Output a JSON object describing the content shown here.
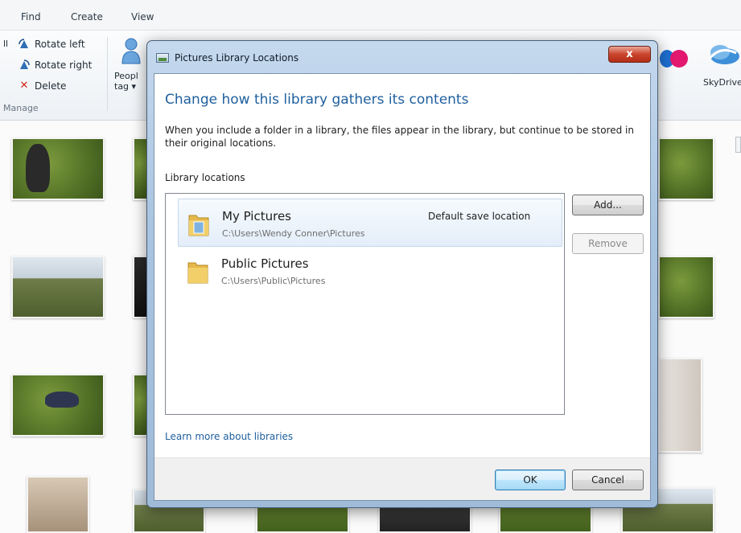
{
  "app": {
    "menu": [
      "Find",
      "Create",
      "View"
    ],
    "ribbon": {
      "items": [
        {
          "icon": "rotate-left-icon",
          "label": "Rotate left"
        },
        {
          "icon": "rotate-right-icon",
          "label": "Rotate right"
        },
        {
          "icon": "delete-icon",
          "label": "Delete"
        }
      ],
      "group_label": "Manage",
      "people_tag_line1": "Peopl",
      "people_tag_line2": "tag ▾",
      "skydrive_label": "SkyDrive"
    }
  },
  "dialog": {
    "title": "Pictures Library Locations",
    "close_glyph": "x",
    "heading": "Change how this library gathers its contents",
    "description": "When you include a folder in a library, the files appear in the library, but continue to be stored in their original locations.",
    "section_label": "Library locations",
    "locations": [
      {
        "name": "My Pictures",
        "path": "C:\\Users\\Wendy Conner\\Pictures",
        "badge": "Default save location",
        "selected": true
      },
      {
        "name": "Public Pictures",
        "path": "C:\\Users\\Public\\Pictures",
        "badge": "",
        "selected": false
      }
    ],
    "buttons": {
      "add": "Add...",
      "remove": "Remove",
      "ok": "OK",
      "cancel": "Cancel"
    },
    "link": "Learn more about libraries"
  },
  "colors": {
    "heading_blue": "#1e5f9e",
    "close_red": "#c9452c",
    "dialog_frame": "#a9c4e0"
  }
}
